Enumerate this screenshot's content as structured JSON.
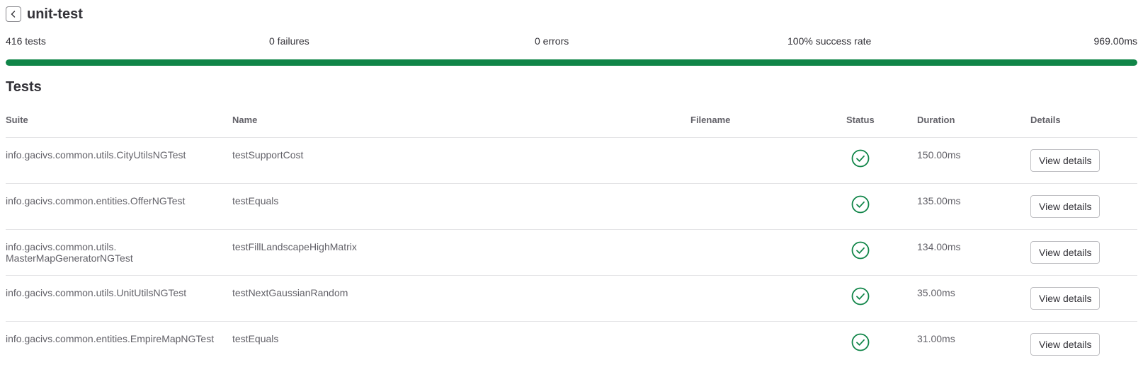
{
  "header": {
    "title": "unit-test",
    "back_icon": "chevron-left-icon"
  },
  "summary": {
    "tests": "416 tests",
    "failures": "0 failures",
    "errors": "0 errors",
    "success_rate": "100% success rate",
    "duration": "969.00ms",
    "progress_percent": 100,
    "progress_color": "#108548"
  },
  "tests": {
    "title": "Tests",
    "columns": {
      "suite": "Suite",
      "name": "Name",
      "filename": "Filename",
      "status": "Status",
      "duration": "Duration",
      "details": "Details"
    },
    "rows": [
      {
        "suite": "info.gacivs.common.utils.CityUtilsNGTest",
        "name": "testSupportCost",
        "filename": "",
        "status": "success",
        "duration": "150.00ms",
        "details_label": "View details"
      },
      {
        "suite": "info.gacivs.common.entities.OfferNGTest",
        "name": "testEquals",
        "filename": "",
        "status": "success",
        "duration": "135.00ms",
        "details_label": "View details"
      },
      {
        "suite": "info.gacivs.common.utils.\nMasterMapGeneratorNGTest",
        "name": "testFillLandscapeHighMatrix",
        "filename": "",
        "status": "success",
        "duration": "134.00ms",
        "details_label": "View details"
      },
      {
        "suite": "info.gacivs.common.utils.UnitUtilsNGTest",
        "name": "testNextGaussianRandom",
        "filename": "",
        "status": "success",
        "duration": "35.00ms",
        "details_label": "View details"
      },
      {
        "suite": "info.gacivs.common.entities.EmpireMapNGTest",
        "name": "testEquals",
        "filename": "",
        "status": "success",
        "duration": "31.00ms",
        "details_label": "View details"
      }
    ],
    "status_icon": "check-circle-icon",
    "status_color": "#108548"
  }
}
